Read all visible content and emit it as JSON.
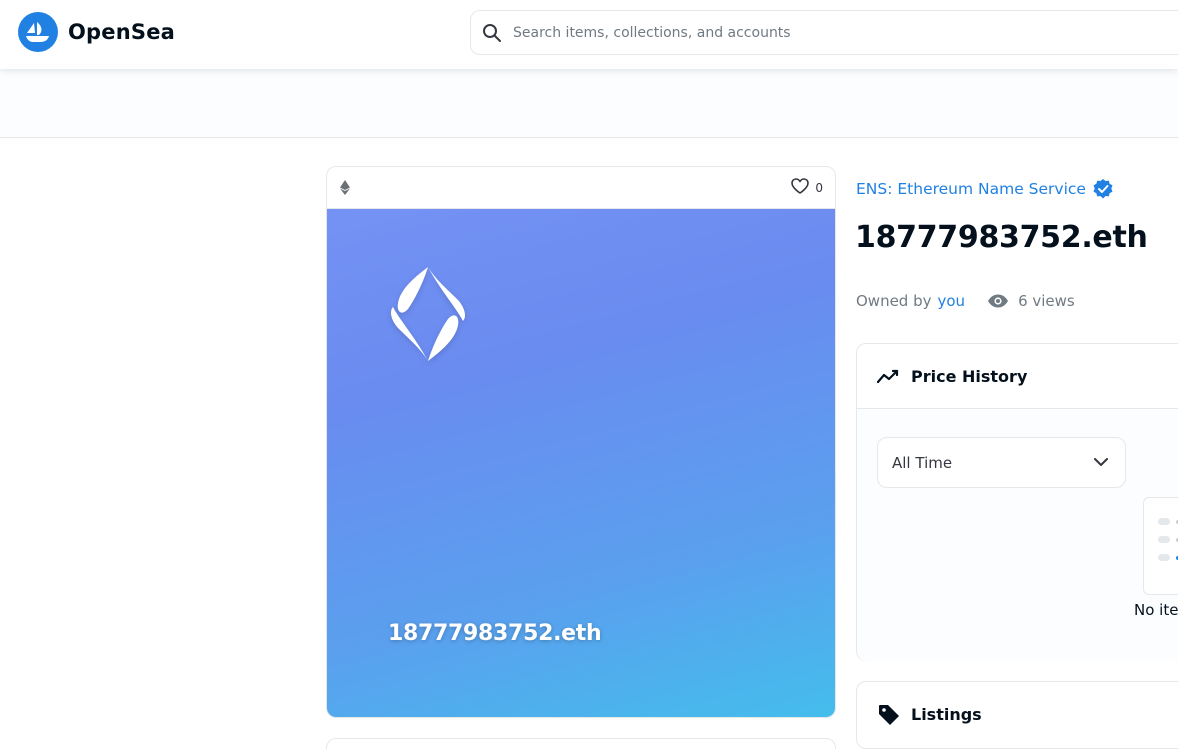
{
  "nav": {
    "brand": "OpenSea",
    "search_placeholder": "Search items, collections, and accounts"
  },
  "item": {
    "favorites_count": "0",
    "image_name": "18777983752.eth",
    "collection": "ENS: Ethereum Name Service",
    "title": "18777983752.eth",
    "owned_by_label": "Owned by",
    "owner": "you",
    "views": "6 views"
  },
  "price_history": {
    "title": "Price History",
    "range_selected": "All Time",
    "empty_text": "No ite"
  },
  "listings": {
    "title": "Listings"
  },
  "colors": {
    "accent": "#2081e2",
    "text": "#04111d",
    "muted": "#707a83",
    "border": "#e5e8eb"
  }
}
